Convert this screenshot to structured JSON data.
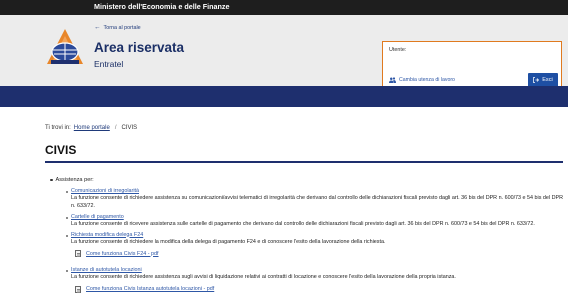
{
  "topbar": {
    "title": "Ministero dell'Economia e delle Finanze"
  },
  "header": {
    "back_link": "Torna al portale",
    "area_title": "Area riservata",
    "area_subtitle": "Entratel"
  },
  "user_box": {
    "label": "Utente:",
    "change_user": "Cambia utenza di lavoro",
    "exit_button": "Esci"
  },
  "breadcrumb": {
    "prefix": "Ti trovi in:",
    "home": "Home portale",
    "separator": "/",
    "current": "CIVIS"
  },
  "page_title": "CIVIS",
  "assistance": {
    "label": "Assistenza per:",
    "items": [
      {
        "link": "Comunicazioni di irregolarità",
        "description": "La funzione consente di richiedere assistenza su comunicazioni/avvisi telematici di irregolarità che derivano dal controllo delle dichiarazioni fiscali previsto dagli art. 36 bis del DPR n. 600/73 e 54 bis del DPR n. 633/72."
      },
      {
        "link": "Cartelle di pagamento",
        "description": "La funzione consente di ricevere assistenza sulle cartelle di pagamento che derivano dal controllo delle dichiarazioni fiscali previsto dagli art. 36 bis del DPR n. 600/73 e 54 bis del DPR n. 633/72."
      },
      {
        "link": "Richiesta modifica delega F24",
        "description": "La funzione consente di richiedere la modifica della delega di pagamento F24 e di conoscere l'esito della lavorazione della richiesta.",
        "pdf": "Come funziona Civis F24 - pdf"
      },
      {
        "link": "Istanze di autotutela locazioni",
        "description": "La funzione consente di richiedere assistenza sugli avvisi di liquidazione relativi ai contratti di locazione e conoscere l'esito della lavorazione della propria istanza.",
        "pdf": "Come funziona Civis Istanza autotutela locazioni - pdf"
      }
    ]
  },
  "colors": {
    "brand_dark": "#1e2f6e",
    "accent_orange": "#e07a1f",
    "link_blue": "#2e57a6",
    "button_blue": "#1e4fa3"
  }
}
